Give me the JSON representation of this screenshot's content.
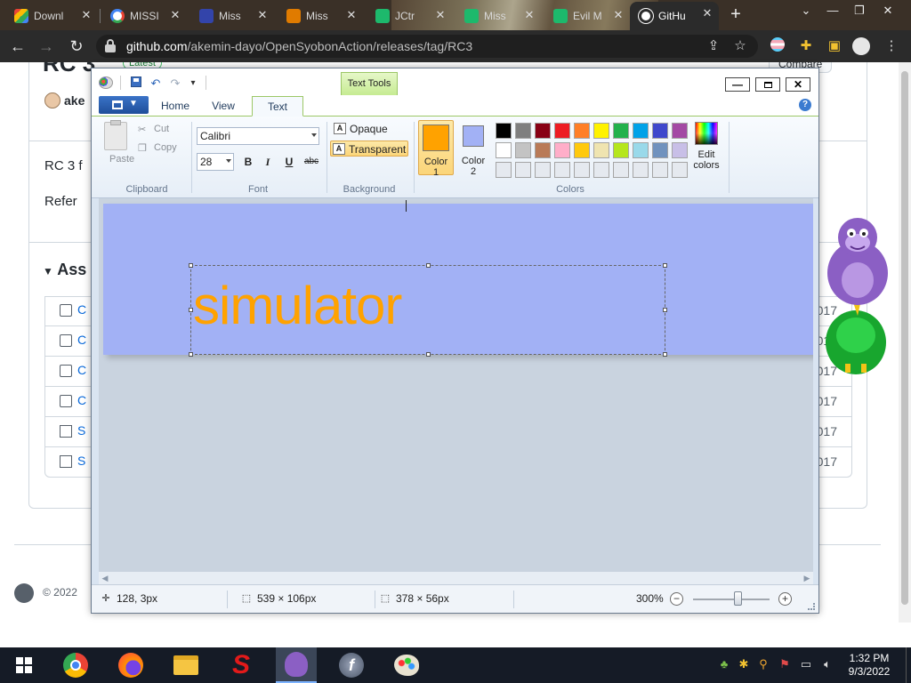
{
  "browser": {
    "tabs": [
      {
        "label": "Downl",
        "color": "#c23a2b"
      },
      {
        "label": "MISSI",
        "color": "#ffffff"
      },
      {
        "label": "Miss",
        "color": "#3344aa"
      },
      {
        "label": "Miss",
        "color": "#e07b00"
      },
      {
        "label": "JCtr",
        "color": "#1db96c"
      },
      {
        "label": "Miss",
        "color": "#1db96c"
      },
      {
        "label": "Evil M",
        "color": "#1db96c"
      },
      {
        "label": "GitHu",
        "color": "#ffffff"
      }
    ],
    "url_host": "github.com",
    "url_path": "/akemin-dayo/OpenSyobonAction/releases/tag/RC3"
  },
  "github": {
    "header_fragment": "RC 3",
    "badge": "Latest",
    "compare": "Compare",
    "author": "ake",
    "body_line1": "RC 3 f",
    "body_line2": "Refer",
    "assets_heading": "Ass",
    "asset_rows": [
      {
        "name": "C",
        "date": "017"
      },
      {
        "name": "C",
        "date": "017"
      },
      {
        "name": "C",
        "date": "017"
      },
      {
        "name": "C",
        "date": "2017"
      },
      {
        "name": "S",
        "date": "2017"
      },
      {
        "name": "S",
        "date": "2017"
      }
    ],
    "footer": "© 2022"
  },
  "paint": {
    "context_tab": "Text Tools",
    "tabs": {
      "home": "Home",
      "view": "View",
      "text": "Text"
    },
    "clipboard": {
      "paste": "Paste",
      "cut": "Cut",
      "copy": "Copy",
      "label": "Clipboard"
    },
    "font": {
      "family": "Calibri",
      "size": "28",
      "bold": "B",
      "italic": "I",
      "underline": "U",
      "strike": "abc",
      "label": "Font"
    },
    "background": {
      "opaque": "Opaque",
      "transparent": "Transparent",
      "label": "Background",
      "selected": "transparent"
    },
    "colors": {
      "color1_label": "Color\n1",
      "color1": "#ffa200",
      "color2_label": "Color\n2",
      "color2": "#a2b1f5",
      "edit_label": "Edit colors",
      "label": "Colors",
      "palette_row1": [
        "#000000",
        "#7f7f7f",
        "#880015",
        "#ed1c24",
        "#ff7f27",
        "#fff200",
        "#22b14c",
        "#00a2e8",
        "#3f48cc",
        "#a349a4"
      ],
      "palette_row2": [
        "#ffffff",
        "#c3c3c3",
        "#b97a57",
        "#ffaec9",
        "#ffc90e",
        "#efe4b0",
        "#b5e61d",
        "#99d9ea",
        "#7092be",
        "#c8bfe7"
      ],
      "palette_row3": [
        "#e5e9ef",
        "#e5e9ef",
        "#e5e9ef",
        "#e5e9ef",
        "#e5e9ef",
        "#e5e9ef",
        "#e5e9ef",
        "#e5e9ef",
        "#e5e9ef",
        "#e5e9ef"
      ]
    },
    "canvas_text": "simulator",
    "canvas_bg": "#a2b1f5",
    "status": {
      "cursor": "128, 3px",
      "selection": "539 × 106px",
      "size": "378 × 56px",
      "zoom": "300%"
    }
  },
  "taskbar": {
    "time": "1:32 PM",
    "date": "9/3/2022"
  }
}
